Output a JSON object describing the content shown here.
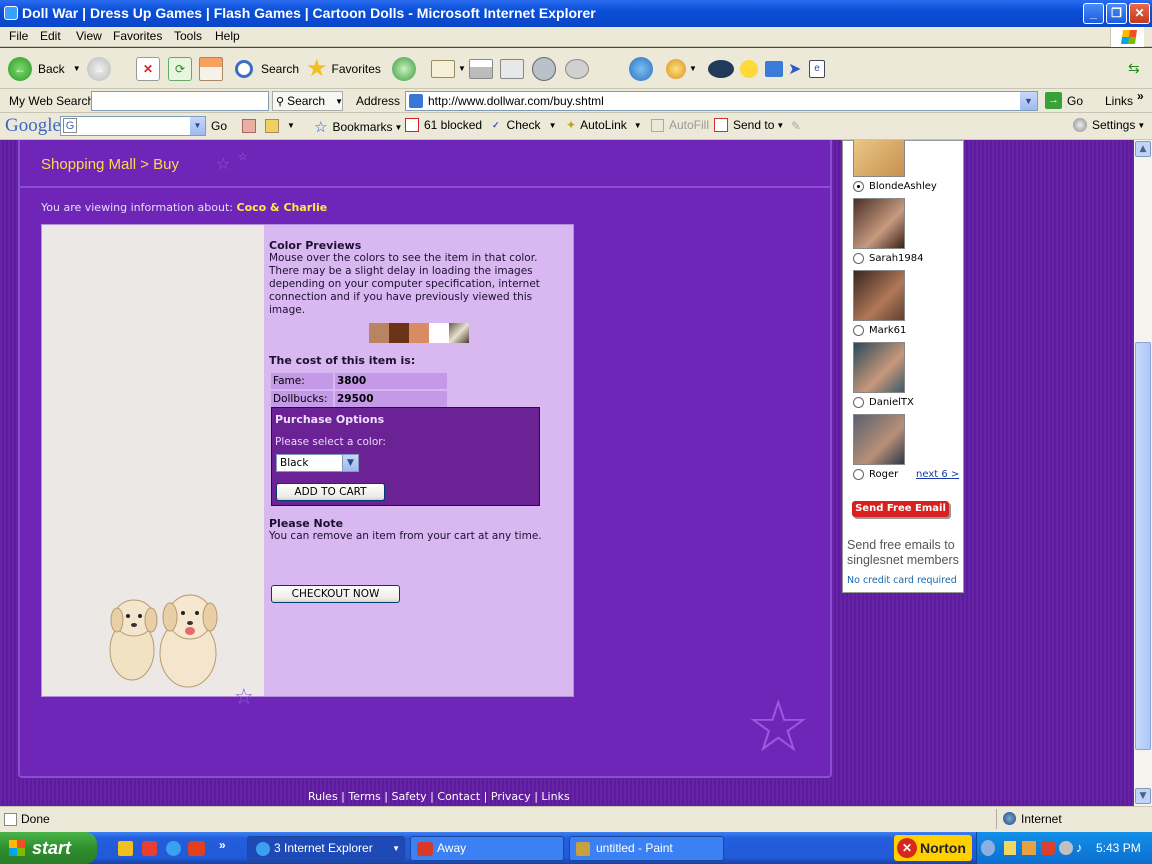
{
  "window": {
    "title": "Doll War | Dress Up Games | Flash Games | Cartoon Dolls - Microsoft Internet Explorer"
  },
  "menu": [
    "File",
    "Edit",
    "View",
    "Favorites",
    "Tools",
    "Help"
  ],
  "toolbar": {
    "back": "Back",
    "search": "Search",
    "favorites": "Favorites"
  },
  "addressbar": {
    "mywebsearch": "My Web Search",
    "search_btn": "Search",
    "address_label": "Address",
    "url": "http://www.dollwar.com/buy.shtml",
    "go": "Go",
    "links": "Links"
  },
  "googlebar": {
    "logo": "Google",
    "go": "Go",
    "bookmarks": "Bookmarks",
    "blocked": "61 blocked",
    "check": "Check",
    "autolink": "AutoLink",
    "autofill": "AutoFill",
    "sendto": "Send to",
    "settings": "Settings"
  },
  "page": {
    "breadcrumb": "Shopping Mall > Buy",
    "viewing_prefix": "You are viewing information about:",
    "item_name": "Coco & Charlie",
    "color_previews_title": "Color Previews",
    "color_previews_text": "Mouse over the colors to see the item in that color. There may be a slight delay in loading the images depending on your computer specification, internet connection and if you have previously viewed this image.",
    "swatches": [
      "#b98462",
      "#6b3318",
      "#d98c64",
      "#ffffff",
      "#8a7a68"
    ],
    "cost_title": "The cost of this item is:",
    "cost": [
      {
        "label": "Fame:",
        "value": "3800"
      },
      {
        "label": "Dollbucks:",
        "value": "29500"
      }
    ],
    "purchase_title": "Purchase Options",
    "select_label": "Please select a color:",
    "selected_color": "Black",
    "add_to_cart": "ADD TO CART",
    "note_title": "Please Note",
    "note_text": "You can remove an item from your cart at any time.",
    "checkout": "CHECKOUT NOW",
    "footer_links": [
      "Rules",
      "Terms",
      "Safety",
      "Contact",
      "Privacy",
      "Links"
    ]
  },
  "sidead": {
    "people": [
      {
        "name": "BlondeAshley",
        "selected": true
      },
      {
        "name": "Sarah1984",
        "selected": false
      },
      {
        "name": "Mark61",
        "selected": false
      },
      {
        "name": "DanielTX",
        "selected": false
      },
      {
        "name": "Roger",
        "selected": false
      }
    ],
    "next": "next 6 >",
    "send_btn": "Send Free Email",
    "tagline": "Send free emails to singlesnet members",
    "no_cc": "No credit card required"
  },
  "status": {
    "text": "Done",
    "zone": "Internet"
  },
  "taskbar": {
    "start": "start",
    "tasks": [
      "3 Internet Explorer",
      "Away",
      "untitled - Paint"
    ],
    "norton": "Norton",
    "clock": "5:43 PM"
  }
}
